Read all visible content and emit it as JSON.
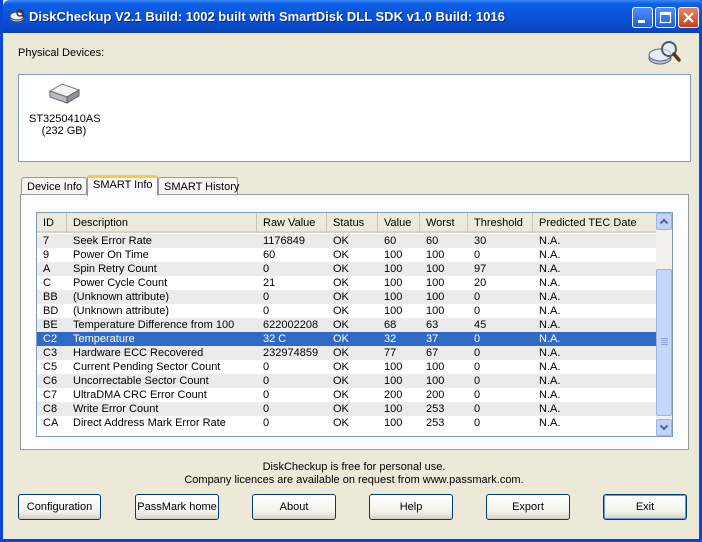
{
  "window": {
    "title": "DiskCheckup V2.1 Build: 1002 built with SmartDisk DLL SDK v1.0 Build: 1016",
    "icon": "disk-app-icon",
    "controls": [
      "minimize-icon",
      "maximize-icon",
      "close-icon"
    ]
  },
  "devices": {
    "label": "Physical Devices:",
    "items": [
      {
        "name": "ST3250410AS",
        "size": "(232 GB)",
        "icon": "hard-disk-icon"
      }
    ]
  },
  "tabs": [
    {
      "label": "Device Info",
      "active": false
    },
    {
      "label": "SMART Info",
      "active": true
    },
    {
      "label": "SMART History",
      "active": false
    }
  ],
  "table": {
    "columns": [
      "ID",
      "Description",
      "Raw Value",
      "Status",
      "Value",
      "Worst",
      "Threshold",
      "Predicted TEC Date"
    ],
    "rows": [
      [
        "7",
        "Seek Error Rate",
        "1176849",
        "OK",
        "60",
        "60",
        "30",
        "N.A."
      ],
      [
        "9",
        "Power On Time",
        "60",
        "OK",
        "100",
        "100",
        "0",
        "N.A."
      ],
      [
        "A",
        "Spin Retry Count",
        "0",
        "OK",
        "100",
        "100",
        "97",
        "N.A."
      ],
      [
        "C",
        "Power Cycle Count",
        "21",
        "OK",
        "100",
        "100",
        "20",
        "N.A."
      ],
      [
        "BB",
        "(Unknown attribute)",
        "0",
        "OK",
        "100",
        "100",
        "0",
        "N.A."
      ],
      [
        "BD",
        "(Unknown attribute)",
        "0",
        "OK",
        "100",
        "100",
        "0",
        "N.A."
      ],
      [
        "BE",
        "Temperature Difference from 100",
        "622002208",
        "OK",
        "68",
        "63",
        "45",
        "N.A."
      ],
      [
        "C2",
        "Temperature",
        "32 C",
        "OK",
        "32",
        "37",
        "0",
        "N.A."
      ],
      [
        "C3",
        "Hardware ECC Recovered",
        "232974859",
        "OK",
        "77",
        "67",
        "0",
        "N.A."
      ],
      [
        "C5",
        "Current Pending Sector Count",
        "0",
        "OK",
        "100",
        "100",
        "0",
        "N.A."
      ],
      [
        "C6",
        "Uncorrectable Sector Count",
        "0",
        "OK",
        "100",
        "100",
        "0",
        "N.A."
      ],
      [
        "C7",
        "UltraDMA CRC Error Count",
        "0",
        "OK",
        "200",
        "200",
        "0",
        "N.A."
      ],
      [
        "C8",
        "Write Error Count",
        "0",
        "OK",
        "100",
        "253",
        "0",
        "N.A."
      ],
      [
        "CA",
        "Direct Address Mark Error Rate",
        "0",
        "OK",
        "100",
        "253",
        "0",
        "N.A."
      ]
    ],
    "selected_id": "C2"
  },
  "footer": {
    "line1": "DiskCheckup is free for personal use.",
    "line2": "Company licences are available on request from www.passmark.com."
  },
  "buttons": {
    "configuration": "Configuration",
    "passmark_home": "PassMark home",
    "about": "About",
    "help": "Help",
    "export": "Export",
    "exit": "Exit"
  },
  "colors": {
    "title_bar": "#0a53d6",
    "selection": "#316ac5",
    "tab_highlight": "#ffc73c"
  }
}
